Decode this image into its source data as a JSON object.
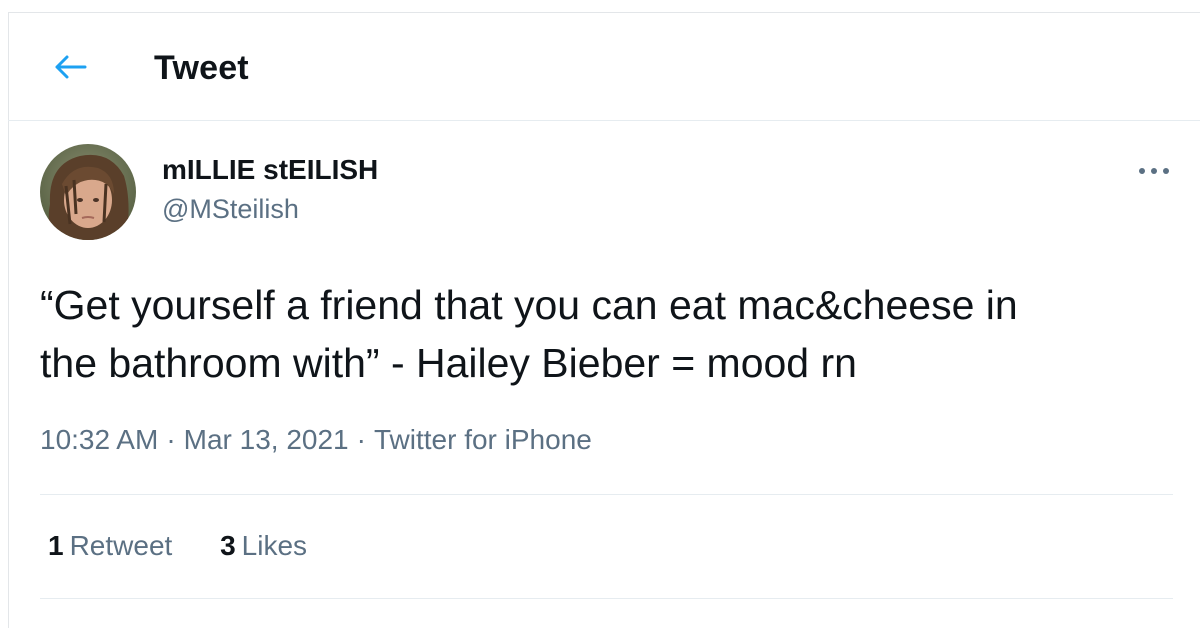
{
  "header": {
    "title": "Tweet",
    "back_icon": "arrow-left-icon",
    "accent_color": "#1da1f2"
  },
  "tweet": {
    "author": {
      "display_name": "mILLIE stEILISH",
      "handle": "@MSteilish",
      "avatar": "profile-photo"
    },
    "more_icon": "more-horizontal-icon",
    "text_line1": "“Get yourself a friend that you can eat mac&cheese in",
    "text_line2": "the bathroom with” - Hailey Bieber = mood rn",
    "time": "10:32 AM",
    "date": "Mar 13, 2021",
    "source": "Twitter for iPhone",
    "separator": "·"
  },
  "stats": {
    "retweets": {
      "count": "1",
      "label": "Retweet"
    },
    "likes": {
      "count": "3",
      "label": "Likes"
    }
  }
}
